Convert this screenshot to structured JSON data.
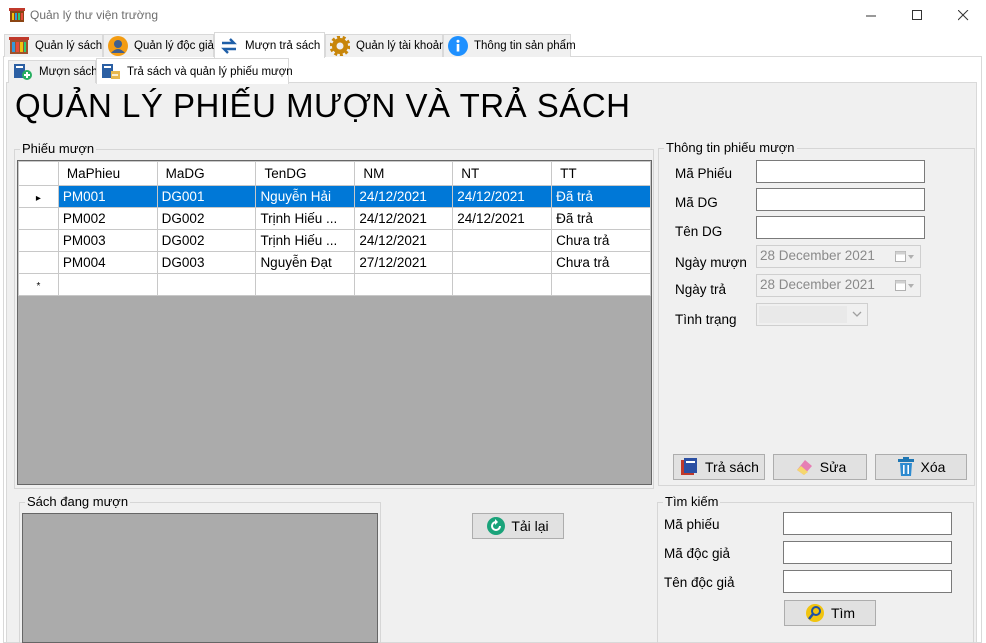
{
  "window": {
    "title": "Quản lý thư viện trường",
    "minimize": "—",
    "maximize": "☐",
    "close": "✕"
  },
  "main_tabs": [
    {
      "label": "Quản lý sách",
      "icon": "bookshelf-icon"
    },
    {
      "label": "Quản lý độc giả",
      "icon": "user-icon"
    },
    {
      "label": "Mượn trả sách",
      "icon": "swap-arrows-icon"
    },
    {
      "label": "Quản lý tài khoản",
      "icon": "gear-icon"
    },
    {
      "label": "Thông tin sản phẩm",
      "icon": "info-icon"
    }
  ],
  "sub_tabs": [
    {
      "label": "Mượn sách",
      "icon": "add-book-icon"
    },
    {
      "label": "Trả sách và quản lý phiếu mượn",
      "icon": "return-book-icon"
    }
  ],
  "page_title": "QUẢN LÝ PHIẾU MƯỢN VÀ TRẢ SÁCH",
  "loans_group": {
    "legend": "Phiếu mượn",
    "columns": [
      "MaPhieu",
      "MaDG",
      "TenDG",
      "NM",
      "NT",
      "TT"
    ],
    "rows": [
      [
        "PM001",
        "DG001",
        "Nguyễn Hải",
        "24/12/2021",
        "24/12/2021",
        "Đã trả"
      ],
      [
        "PM002",
        "DG002",
        "Trịnh Hiếu ...",
        "24/12/2021",
        "24/12/2021",
        "Đã trả"
      ],
      [
        "PM003",
        "DG002",
        "Trịnh Hiếu ...",
        "24/12/2021",
        "",
        "Chưa trả"
      ],
      [
        "PM004",
        "DG003",
        "Nguyễn Đạt",
        "27/12/2021",
        "",
        "Chưa trả"
      ]
    ],
    "current_row_marker": "▸",
    "new_row_marker": "*"
  },
  "details_group": {
    "legend": "Thông tin phiếu mượn",
    "ma_phieu_label": "Mã Phiếu",
    "ma_dg_label": "Mã DG",
    "ten_dg_label": "Tên DG",
    "ngay_muon_label": "Ngày mượn",
    "ngay_muon_value": "28 December 2021",
    "ngay_tra_label": "Ngày trả",
    "ngay_tra_value": "28 December 2021",
    "tinh_trang_label": "Tình trạng",
    "ma_phieu_value": "",
    "ma_dg_value": "",
    "ten_dg_value": ""
  },
  "action_buttons": {
    "return": "Trả sách",
    "edit": "Sửa",
    "delete": "Xóa"
  },
  "borrowed_group": {
    "legend": "Sách đang mượn"
  },
  "reload_button": "Tải lại",
  "search_group": {
    "legend": "Tìm kiếm",
    "ma_phieu_label": "Mã phiếu",
    "ma_doc_gia_label": "Mã độc giả",
    "ten_doc_gia_label": "Tên độc giả",
    "search_button": "Tìm"
  },
  "colors": {
    "selection": "#0078d7",
    "panel": "#f0f0f0",
    "grid_empty": "#ababab"
  }
}
